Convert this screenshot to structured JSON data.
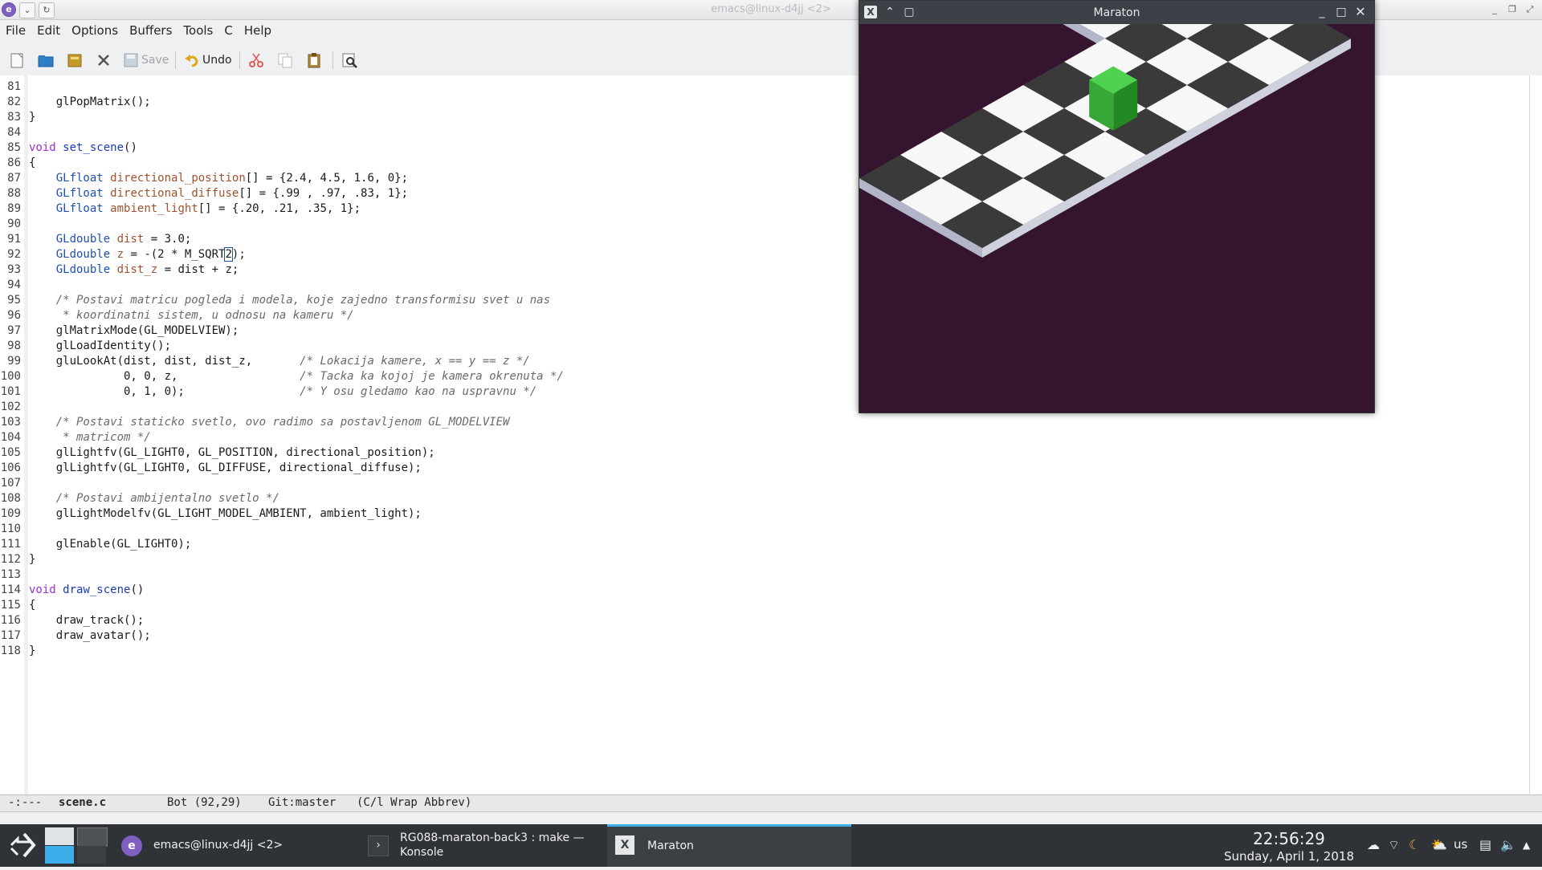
{
  "window": {
    "title": "emacs@linux-d4jj <2>"
  },
  "menu": [
    "File",
    "Edit",
    "Options",
    "Buffers",
    "Tools",
    "C",
    "Help"
  ],
  "toolbar": {
    "save_label": "Save",
    "undo_label": "Undo"
  },
  "lines": [
    {
      "n": "81",
      "t": ""
    },
    {
      "n": "82",
      "t": "    glPopMatrix();"
    },
    {
      "n": "83",
      "t": "}"
    },
    {
      "n": "84",
      "t": ""
    },
    {
      "n": "85",
      "t": "void set_scene()"
    },
    {
      "n": "86",
      "t": "{"
    },
    {
      "n": "87",
      "t": "    GLfloat directional_position[] = {2.4, 4.5, 1.6, 0};"
    },
    {
      "n": "88",
      "t": "    GLfloat directional_diffuse[] = {.99 , .97, .83, 1};"
    },
    {
      "n": "89",
      "t": "    GLfloat ambient_light[] = {.20, .21, .35, 1};"
    },
    {
      "n": "90",
      "t": ""
    },
    {
      "n": "91",
      "t": "    GLdouble dist = 3.0;"
    },
    {
      "n": "92",
      "t": "    GLdouble z = -(2 * M_SQRT2);"
    },
    {
      "n": "93",
      "t": "    GLdouble dist_z = dist + z;"
    },
    {
      "n": "94",
      "t": ""
    },
    {
      "n": "95",
      "t": "    /* Postavi matricu pogleda i modela, koje zajedno transformisu svet u nas"
    },
    {
      "n": "96",
      "t": "     * koordinatni sistem, u odnosu na kameru */"
    },
    {
      "n": "97",
      "t": "    glMatrixMode(GL_MODELVIEW);"
    },
    {
      "n": "98",
      "t": "    glLoadIdentity();"
    },
    {
      "n": "99",
      "t": "    gluLookAt(dist, dist, dist_z,       /* Lokacija kamere, x == y == z */"
    },
    {
      "n": "100",
      "t": "              0, 0, z,                  /* Tacka ka kojoj je kamera okrenuta */"
    },
    {
      "n": "101",
      "t": "              0, 1, 0);                 /* Y osu gledamo kao na uspravnu */"
    },
    {
      "n": "102",
      "t": ""
    },
    {
      "n": "103",
      "t": "    /* Postavi staticko svetlo, ovo radimo sa postavljenom GL_MODELVIEW"
    },
    {
      "n": "104",
      "t": "     * matricom */"
    },
    {
      "n": "105",
      "t": "    glLightfv(GL_LIGHT0, GL_POSITION, directional_position);"
    },
    {
      "n": "106",
      "t": "    glLightfv(GL_LIGHT0, GL_DIFFUSE, directional_diffuse);"
    },
    {
      "n": "107",
      "t": ""
    },
    {
      "n": "108",
      "t": "    /* Postavi ambijentalno svetlo */"
    },
    {
      "n": "109",
      "t": "    glLightModelfv(GL_LIGHT_MODEL_AMBIENT, ambient_light);"
    },
    {
      "n": "110",
      "t": ""
    },
    {
      "n": "111",
      "t": "    glEnable(GL_LIGHT0);"
    },
    {
      "n": "112",
      "t": "}"
    },
    {
      "n": "113",
      "t": ""
    },
    {
      "n": "114",
      "t": "void draw_scene()"
    },
    {
      "n": "115",
      "t": "{"
    },
    {
      "n": "116",
      "t": "    draw_track();"
    },
    {
      "n": "117",
      "t": "    draw_avatar();"
    },
    {
      "n": "118",
      "t": "}"
    }
  ],
  "modeline": {
    "status": "-:---",
    "buffer": "scene.c",
    "position": "Bot (92,29)",
    "vcs": "Git:master",
    "modes": "(C/l Wrap Abbrev)"
  },
  "maraton": {
    "title": "Maraton"
  },
  "taskbar": {
    "tasks": [
      {
        "label": "emacs@linux-d4jj <2>"
      },
      {
        "label1": "RG088-maraton-back3 : make —",
        "label2": "Konsole"
      },
      {
        "label": "Maraton"
      }
    ],
    "keyboard": "us",
    "time": "22:56:29",
    "date": "Sunday, April 1, 2018"
  },
  "colors": {
    "accent": "#3daee9",
    "scene_bg": "#34142f",
    "cube": "#3cbf3c"
  }
}
